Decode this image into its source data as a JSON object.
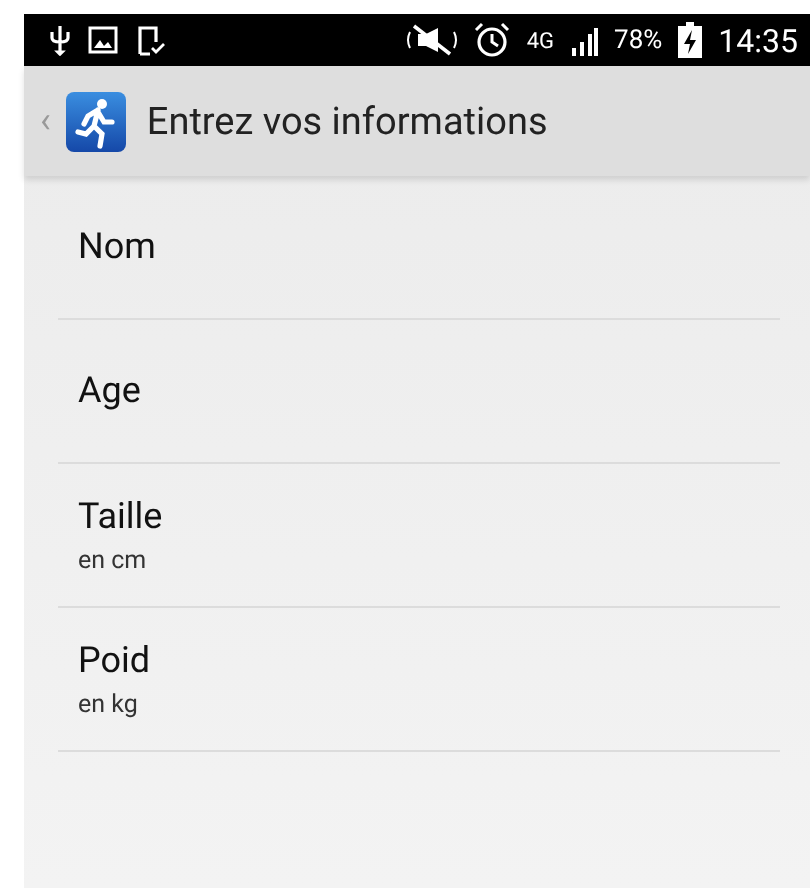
{
  "status_bar": {
    "network": "4G",
    "battery": "78%",
    "time": "14:35"
  },
  "action_bar": {
    "back": "‹",
    "title": "Entrez vos informations"
  },
  "fields": [
    {
      "label": "Nom"
    },
    {
      "label": "Age"
    },
    {
      "label": "Taille",
      "hint": "en cm"
    },
    {
      "label": "Poid",
      "hint": "en kg"
    }
  ]
}
